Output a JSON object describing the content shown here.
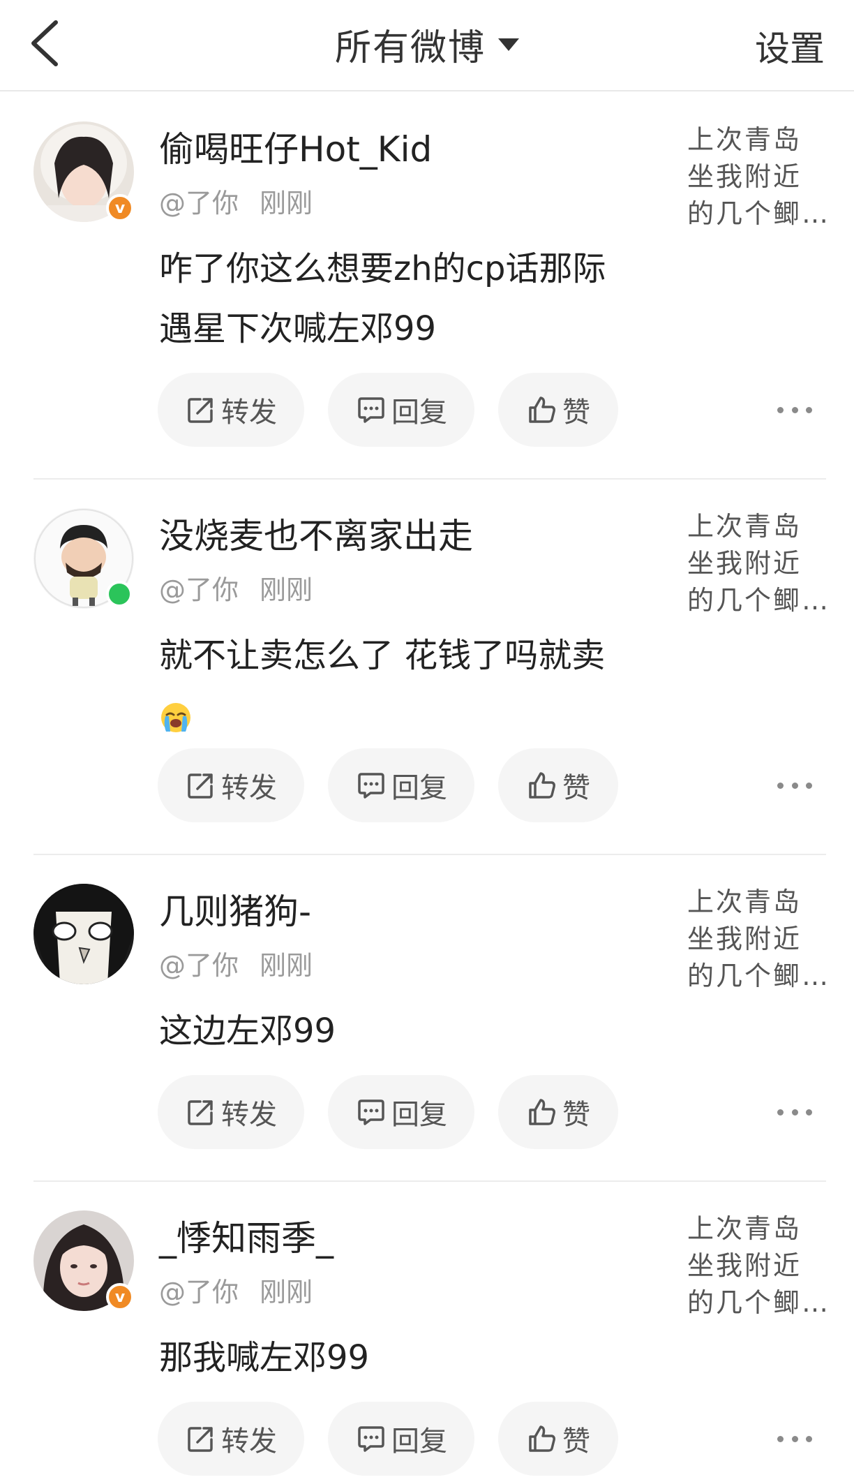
{
  "header": {
    "back_icon": "chevron-left-icon",
    "title": "所有微博",
    "dropdown_icon": "caret-down-icon",
    "settings_label": "设置"
  },
  "actions": {
    "forward_label": "转发",
    "reply_label": "回复",
    "like_label": "赞"
  },
  "posts": [
    {
      "name": "偷喝旺仔Hot_Kid",
      "mention": "@了你",
      "time": "刚刚",
      "badge": "v",
      "body_lines": [
        "咋了你这么想要zh的cp话那际",
        "遇星下次喊左邓99"
      ],
      "side_lines": [
        "上次青岛",
        "坐我附近",
        "的几个鲫…"
      ]
    },
    {
      "name": "没烧麦也不离家出走",
      "mention": "@了你",
      "time": "刚刚",
      "badge": "online",
      "body_lines": [
        "就不让卖怎么了 花钱了吗就卖"
      ],
      "body_emoji": "loudly-crying-face-emoji",
      "side_lines": [
        "上次青岛",
        "坐我附近",
        "的几个鲫…"
      ]
    },
    {
      "name": "几则猪狗-",
      "mention": "@了你",
      "time": "刚刚",
      "badge": "none",
      "body_lines": [
        "这边左邓99"
      ],
      "side_lines": [
        "上次青岛",
        "坐我附近",
        "的几个鲫…"
      ]
    },
    {
      "name": "_悸知雨季_",
      "mention": "@了你",
      "time": "刚刚",
      "badge": "v",
      "body_lines": [
        "那我喊左邓99"
      ],
      "side_lines": [
        "上次青岛",
        "坐我附近",
        "的几个鲫…"
      ]
    }
  ],
  "colors": {
    "accent_badge": "#f08a24",
    "online": "#2bc45a",
    "button_bg": "#f5f5f5",
    "muted_text": "#9a9a9a"
  }
}
